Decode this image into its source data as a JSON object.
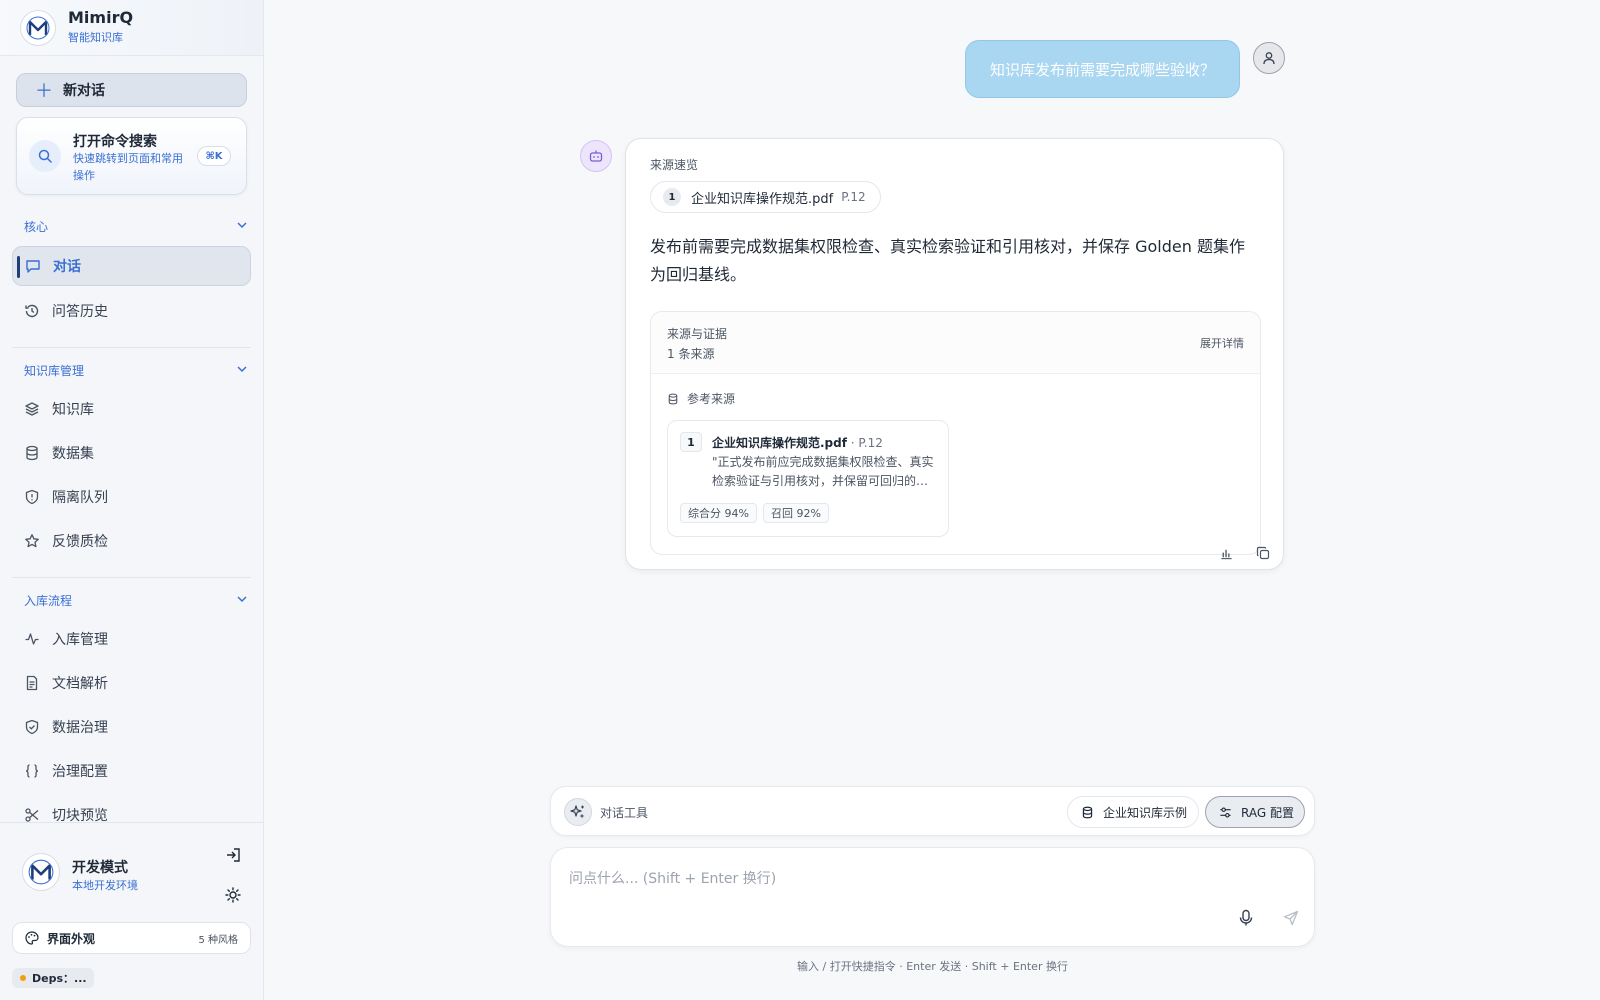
{
  "brand": {
    "name": "MimirQ",
    "subtitle": "智能知识库"
  },
  "sidebar": {
    "new_chat_label": "新对话",
    "command_search": {
      "title": "打开命令搜索",
      "subtitle": "快速跳转到页面和常用操作",
      "shortcut": "⌘K"
    },
    "sections": {
      "core": {
        "label": "核心",
        "items": [
          {
            "label": "对话",
            "icon": "chat-icon"
          },
          {
            "label": "问答历史",
            "icon": "history-icon"
          }
        ]
      },
      "kb_management": {
        "label": "知识库管理",
        "items": [
          {
            "label": "知识库",
            "icon": "layers-icon"
          },
          {
            "label": "数据集",
            "icon": "database-icon"
          },
          {
            "label": "隔离队列",
            "icon": "shield-alert-icon"
          },
          {
            "label": "反馈质检",
            "icon": "star-icon"
          }
        ]
      },
      "ingest": {
        "label": "入库流程",
        "items": [
          {
            "label": "入库管理",
            "icon": "activity-icon"
          },
          {
            "label": "文档解析",
            "icon": "file-text-icon"
          },
          {
            "label": "数据治理",
            "icon": "shield-check-icon"
          },
          {
            "label": "治理配置",
            "icon": "braces-icon"
          },
          {
            "label": "切块预览",
            "icon": "scissors-icon"
          }
        ]
      }
    },
    "footer": {
      "mode_title": "开发模式",
      "mode_subtitle": "本地开发环境",
      "appearance_label": "界面外观",
      "appearance_count": "5 种风格",
      "deps_label": "Deps：..."
    }
  },
  "conversation": {
    "user_message": "知识库发布前需要完成哪些验收？",
    "answer": {
      "sources_title": "来源速览",
      "source_chip": {
        "index": "1",
        "name": "企业知识库操作规范.pdf",
        "page": "P.12"
      },
      "text": "发布前需要完成数据集权限检查、真实检索验证和引用核对，并保存 Golden 题集作为回归基线。",
      "evidence": {
        "title": "来源与证据",
        "count": "1 条来源",
        "expand_label": "展开详情",
        "ref_label": "参考来源",
        "reference": {
          "index": "1",
          "name": "企业知识库操作规范.pdf",
          "page": " · P.12",
          "excerpt": "\"正式发布前应完成数据集权限检查、真实检索验证与引用核对，并保留可回归的…",
          "score": "综合分 94%",
          "recall": "召回 92%"
        }
      }
    }
  },
  "composer": {
    "tools_label": "对话工具",
    "kb_button": "企业知识库示例",
    "rag_button": "RAG 配置",
    "placeholder": "问点什么... (Shift + Enter 换行)",
    "hint": "输入 / 打开快捷指令 · Enter 发送 · Shift + Enter 换行"
  },
  "colors": {
    "accent": "#3b6fd4",
    "user_bubble": "#a9d6f0",
    "bot_avatar": "#ede5fb"
  }
}
